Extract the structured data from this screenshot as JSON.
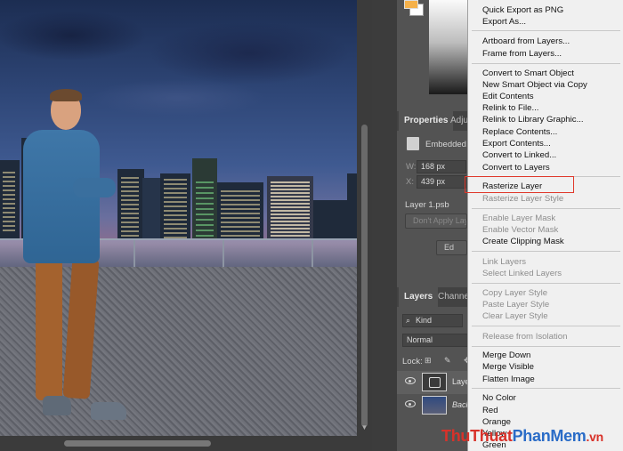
{
  "properties_panel": {
    "tab_properties": "Properties",
    "tab_adjust": "Adju",
    "embedded_label": "Embedded S",
    "w_label": "W:",
    "w_value": "168 px",
    "x_label": "X:",
    "x_value": "439 px",
    "layer_file": "Layer 1.psb",
    "dont_apply": "Don't Apply Lay",
    "edit_btn": "Ed"
  },
  "layers_panel": {
    "tab_layers": "Layers",
    "tab_channels": "Channe",
    "filter_kind": "Kind",
    "blend_mode": "Normal",
    "lock_label": "Lock:",
    "layers": [
      {
        "name": "Laye"
      },
      {
        "name": "Back"
      }
    ]
  },
  "context_menu": {
    "items": [
      {
        "label": "Quick Export as PNG",
        "enabled": true
      },
      {
        "label": "Export As...",
        "enabled": true
      },
      {
        "label": "Artboard from Layers...",
        "enabled": true
      },
      {
        "label": "Frame from Layers...",
        "enabled": true
      },
      {
        "label": "Convert to Smart Object",
        "enabled": true
      },
      {
        "label": "New Smart Object via Copy",
        "enabled": true
      },
      {
        "label": "Edit Contents",
        "enabled": true
      },
      {
        "label": "Relink to File...",
        "enabled": true
      },
      {
        "label": "Relink to Library Graphic...",
        "enabled": true
      },
      {
        "label": "Replace Contents...",
        "enabled": true
      },
      {
        "label": "Export Contents...",
        "enabled": true
      },
      {
        "label": "Convert to Linked...",
        "enabled": true
      },
      {
        "label": "Convert to Layers",
        "enabled": true
      },
      {
        "label": "Rasterize Layer",
        "enabled": true
      },
      {
        "label": "Rasterize Layer Style",
        "enabled": false
      },
      {
        "label": "Enable Layer Mask",
        "enabled": false
      },
      {
        "label": "Enable Vector Mask",
        "enabled": false
      },
      {
        "label": "Create Clipping Mask",
        "enabled": true
      },
      {
        "label": "Link Layers",
        "enabled": false
      },
      {
        "label": "Select Linked Layers",
        "enabled": false
      },
      {
        "label": "Copy Layer Style",
        "enabled": false
      },
      {
        "label": "Paste Layer Style",
        "enabled": false
      },
      {
        "label": "Clear Layer Style",
        "enabled": false
      },
      {
        "label": "Release from Isolation",
        "enabled": false
      },
      {
        "label": "Merge Down",
        "enabled": true
      },
      {
        "label": "Merge Visible",
        "enabled": true
      },
      {
        "label": "Flatten Image",
        "enabled": true
      },
      {
        "label": "No Color",
        "enabled": true
      },
      {
        "label": "Red",
        "enabled": true
      },
      {
        "label": "Orange",
        "enabled": true
      },
      {
        "label": "Yellow",
        "enabled": true
      },
      {
        "label": "Green",
        "enabled": true
      }
    ],
    "highlighted": "Rasterize Layer"
  },
  "watermark": {
    "part1": "Thu",
    "part2": "Thuat",
    "part3": "PhanMem",
    "part4": ".vn"
  },
  "colors": {
    "foreground_swatch": "#f5b14a",
    "highlight_border": "#e0382b",
    "menu_bg": "#f0f0f0"
  }
}
